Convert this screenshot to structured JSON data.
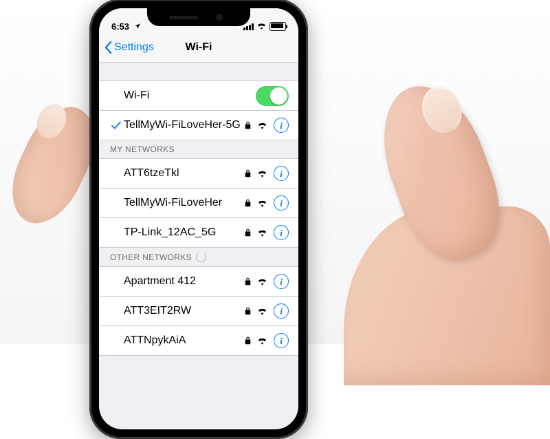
{
  "status_bar": {
    "time": "6:53"
  },
  "nav": {
    "back_label": "Settings",
    "title": "Wi-Fi"
  },
  "wifi_toggle": {
    "label": "Wi-Fi",
    "on": true
  },
  "connected": {
    "name": "TellMyWi-FiLoveHer-5G",
    "secured": true
  },
  "sections": {
    "my_networks": {
      "header": "MY NETWORKS",
      "items": [
        {
          "name": "ATT6tzeTkl",
          "secured": true
        },
        {
          "name": "TellMyWi-FiLoveHer",
          "secured": true
        },
        {
          "name": "TP-Link_12AC_5G",
          "secured": true
        }
      ]
    },
    "other_networks": {
      "header": "OTHER NETWORKS",
      "items": [
        {
          "name": "Apartment 412",
          "secured": true
        },
        {
          "name": "ATT3EIT2RW",
          "secured": true
        },
        {
          "name": "ATTNpykAiA",
          "secured": true
        }
      ]
    }
  }
}
